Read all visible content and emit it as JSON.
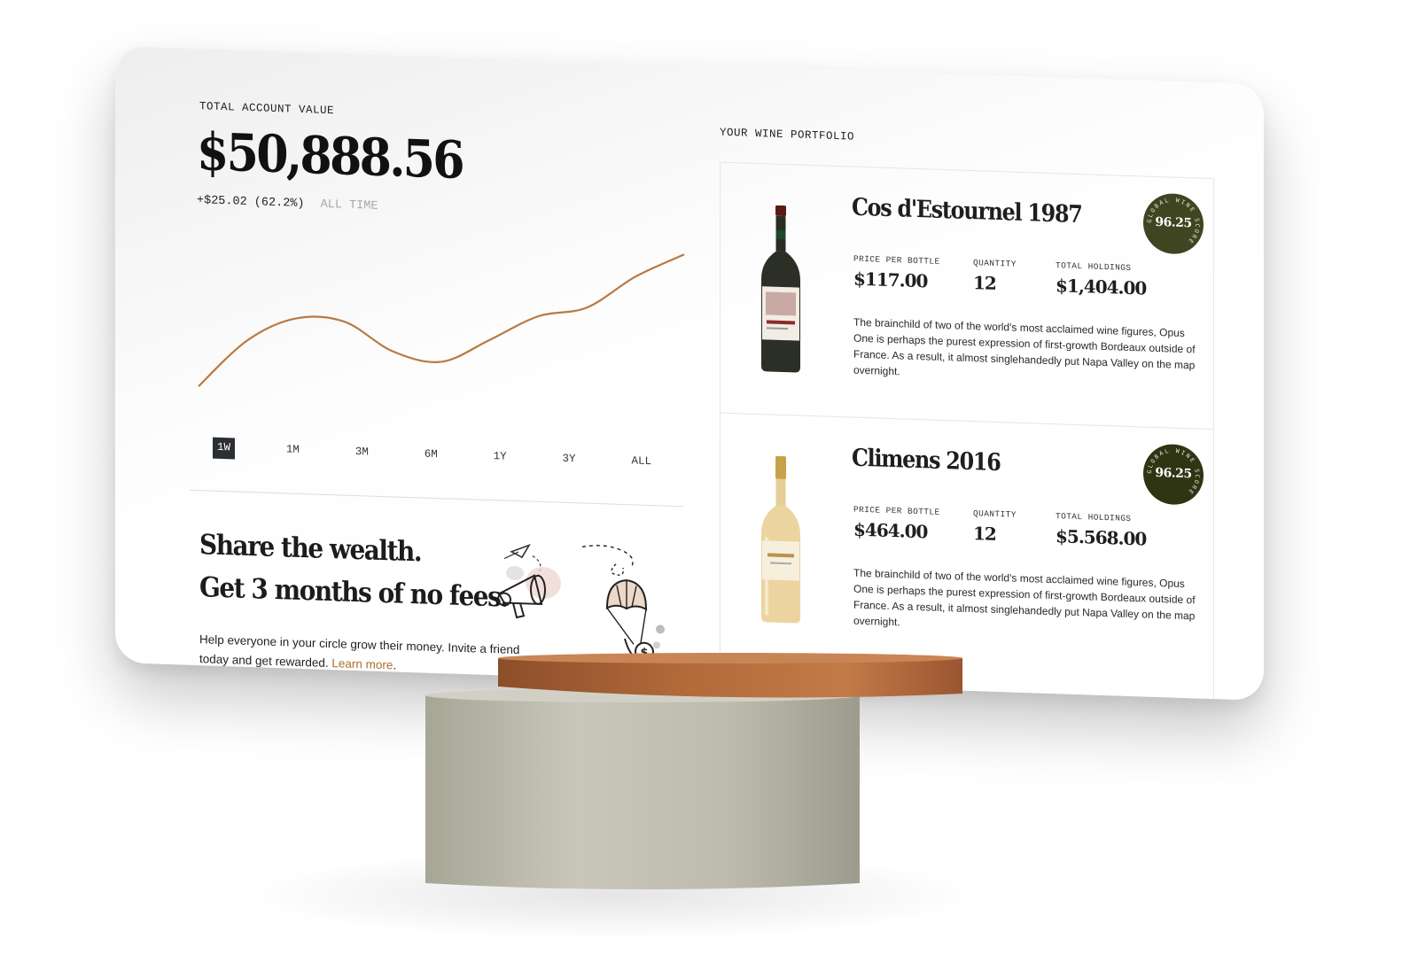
{
  "account": {
    "total_label": "TOTAL ACCOUNT VALUE",
    "total_value": "$50,888.56",
    "change": "+$25.02 (62.2%)",
    "change_period": "ALL TIME"
  },
  "chart_data": {
    "type": "line",
    "title": "",
    "xlabel": "",
    "ylabel": "",
    "series": [
      {
        "values": [
          0.0,
          0.32,
          0.48,
          0.47,
          0.28,
          0.22,
          0.38,
          0.55,
          0.62,
          0.84,
          1.0
        ]
      }
    ],
    "color": "#b87a43",
    "grid": false,
    "selected_range": "1W"
  },
  "time_ranges": [
    "1W",
    "1M",
    "3M",
    "6M",
    "1Y",
    "3Y",
    "ALL"
  ],
  "promo": {
    "headline_1": "Share the wealth.",
    "headline_2": "Get 3 months of no fees.",
    "body": "Help everyone in your circle grow their money. Invite a friend today and get rewarded.",
    "link": "Learn more",
    "link_color": "#b06b2b"
  },
  "portfolio": {
    "label": "YOUR WINE PORTFOLIO",
    "wines": [
      {
        "name": "Cos d'Estournel 1987",
        "score": "96.25",
        "score_ring": "GLOBAL WINE SCORE",
        "price_label": "PRICE PER BOTTLE",
        "price": "$117.00",
        "quantity_label": "QUANTITY",
        "quantity": "12",
        "holdings_label": "TOTAL HOLDINGS",
        "holdings": "$1,404.00",
        "description": "The brainchild of two of the world's most acclaimed wine figures, Opus One is perhaps the purest expression of first-growth Bordeaux outside of France. As a result, it almost singlehandedly put Napa Valley on the map overnight.",
        "bottle_icon": "red-wine-bottle-icon",
        "badge_color": "#3e4520"
      },
      {
        "name": "Climens 2016",
        "score": "96.25",
        "score_ring": "GLOBAL WINE SCORE",
        "price_label": "PRICE PER BOTTLE",
        "price": "$464.00",
        "quantity_label": "QUANTITY",
        "quantity": "12",
        "holdings_label": "TOTAL HOLDINGS",
        "holdings": "$5.568.00",
        "description": "The brainchild of two of the world's most acclaimed wine figures, Opus One is perhaps the purest expression of first-growth Bordeaux outside of France. As a result, it almost singlehandedly put Napa Valley on the map overnight.",
        "bottle_icon": "white-wine-bottle-icon",
        "badge_color": "#2f3413"
      }
    ]
  }
}
